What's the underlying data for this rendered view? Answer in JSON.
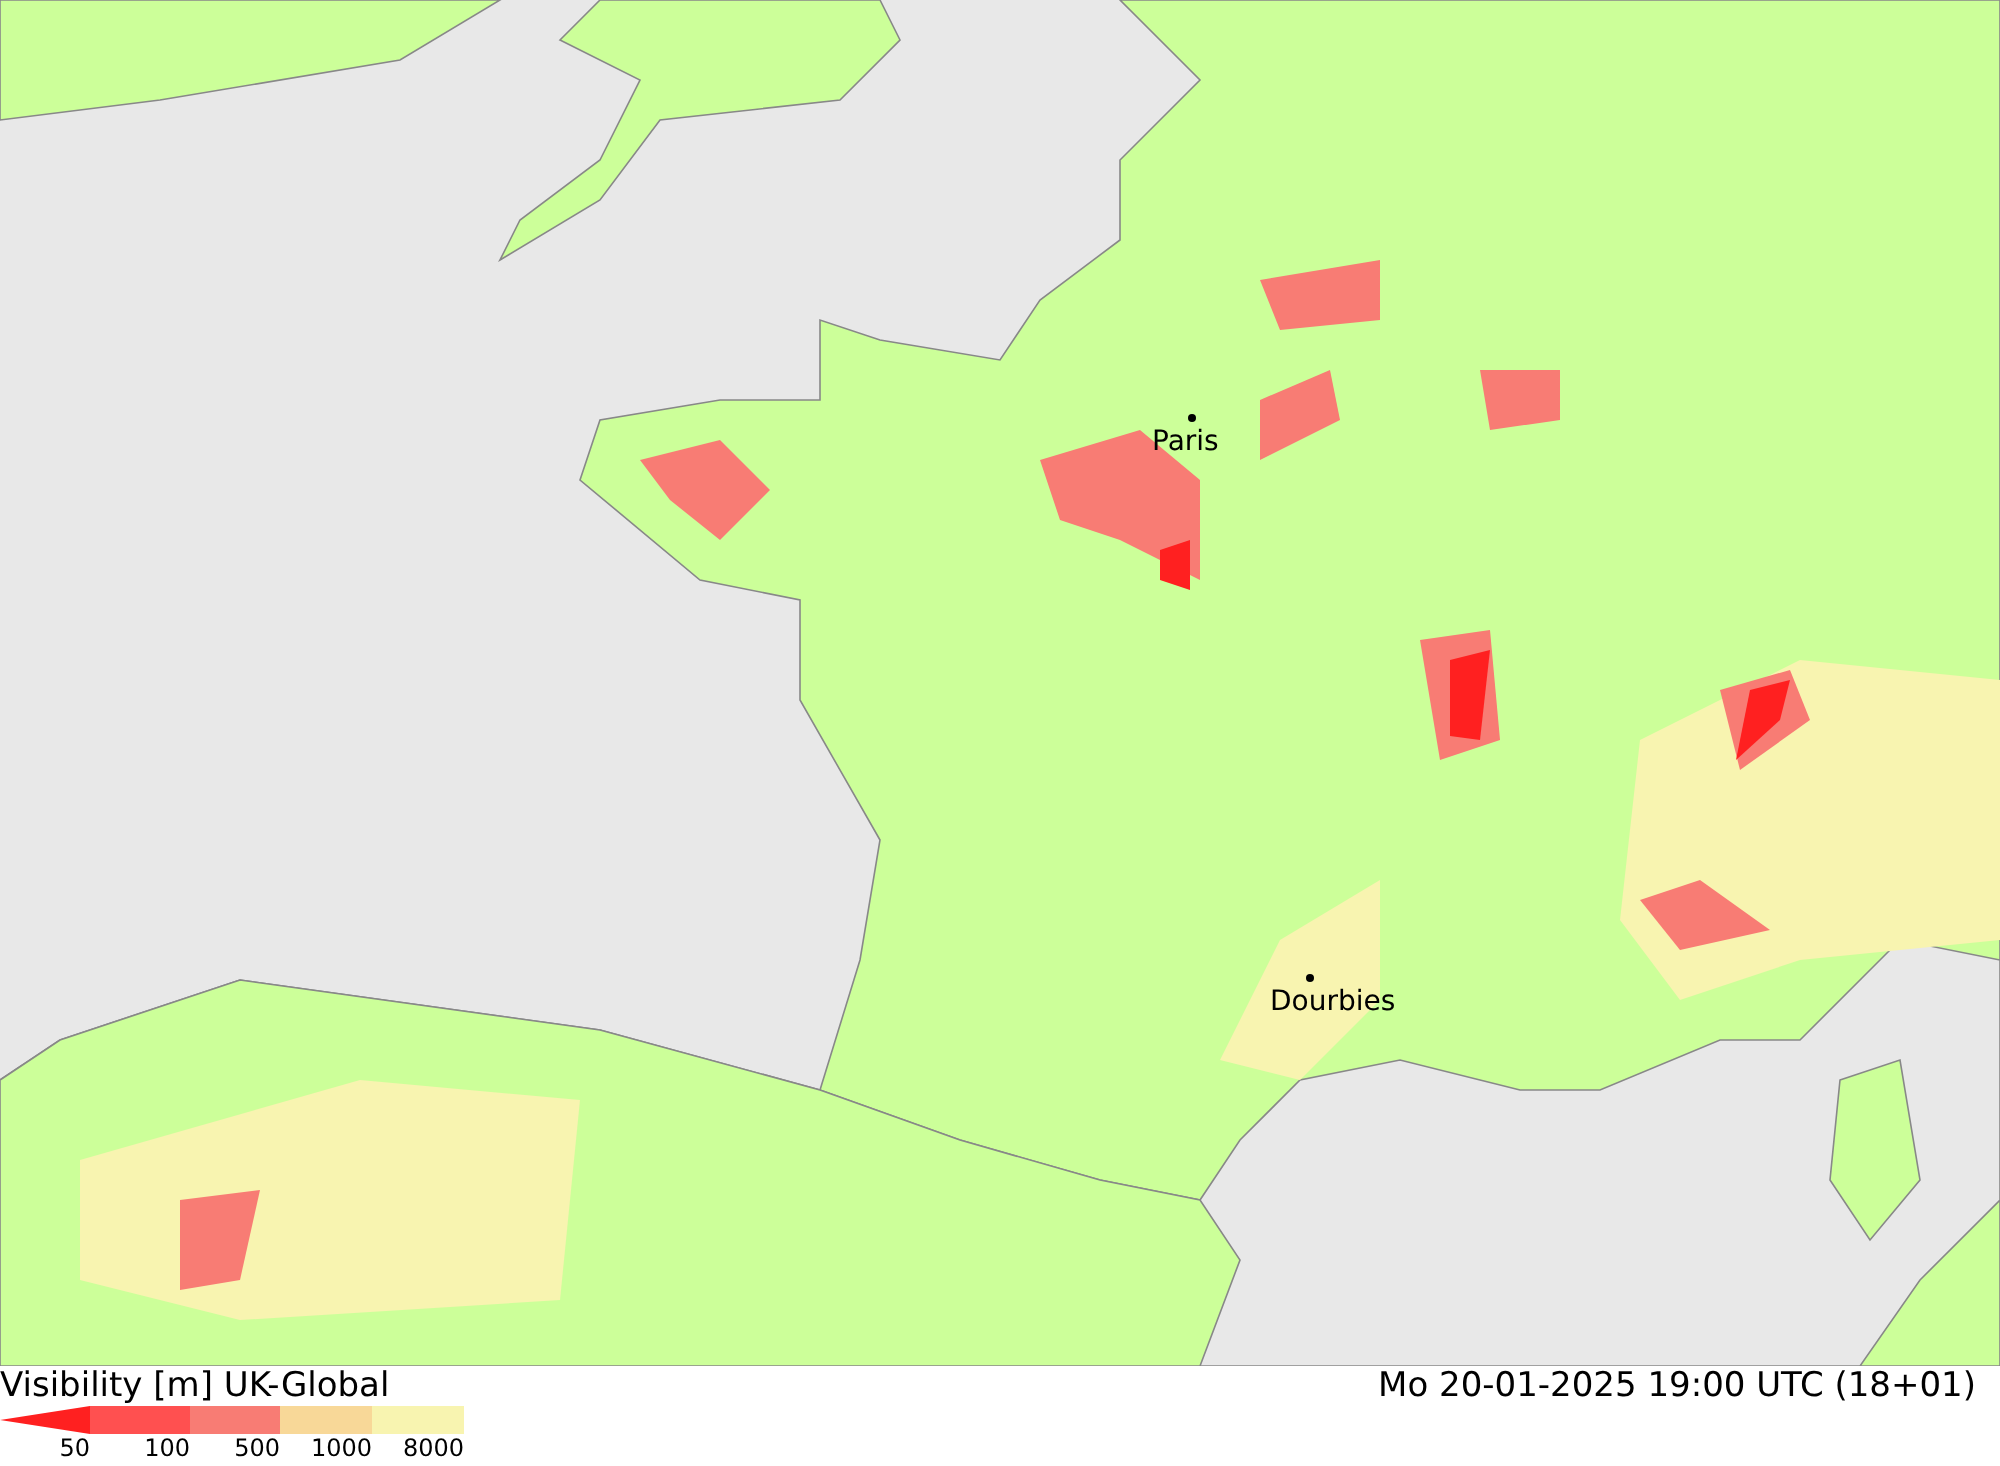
{
  "map": {
    "cities": [
      {
        "name": "Paris"
      },
      {
        "name": "Dourbies"
      }
    ]
  },
  "footer": {
    "title": "Visibility [m] UK-Global",
    "timestamp": "Mo 20-01-2025 19:00 UTC (18+01)"
  },
  "legend": [
    {
      "label": "50",
      "color": "#ff2020",
      "kind": "wedge"
    },
    {
      "label": "100",
      "color": "#ff5050",
      "kind": "band"
    },
    {
      "label": "500",
      "color": "#f87c74",
      "kind": "band"
    },
    {
      "label": "1000",
      "color": "#f8d898",
      "kind": "band"
    },
    {
      "label": "8000",
      "color": "#f8f4b0",
      "kind": "band"
    }
  ]
}
